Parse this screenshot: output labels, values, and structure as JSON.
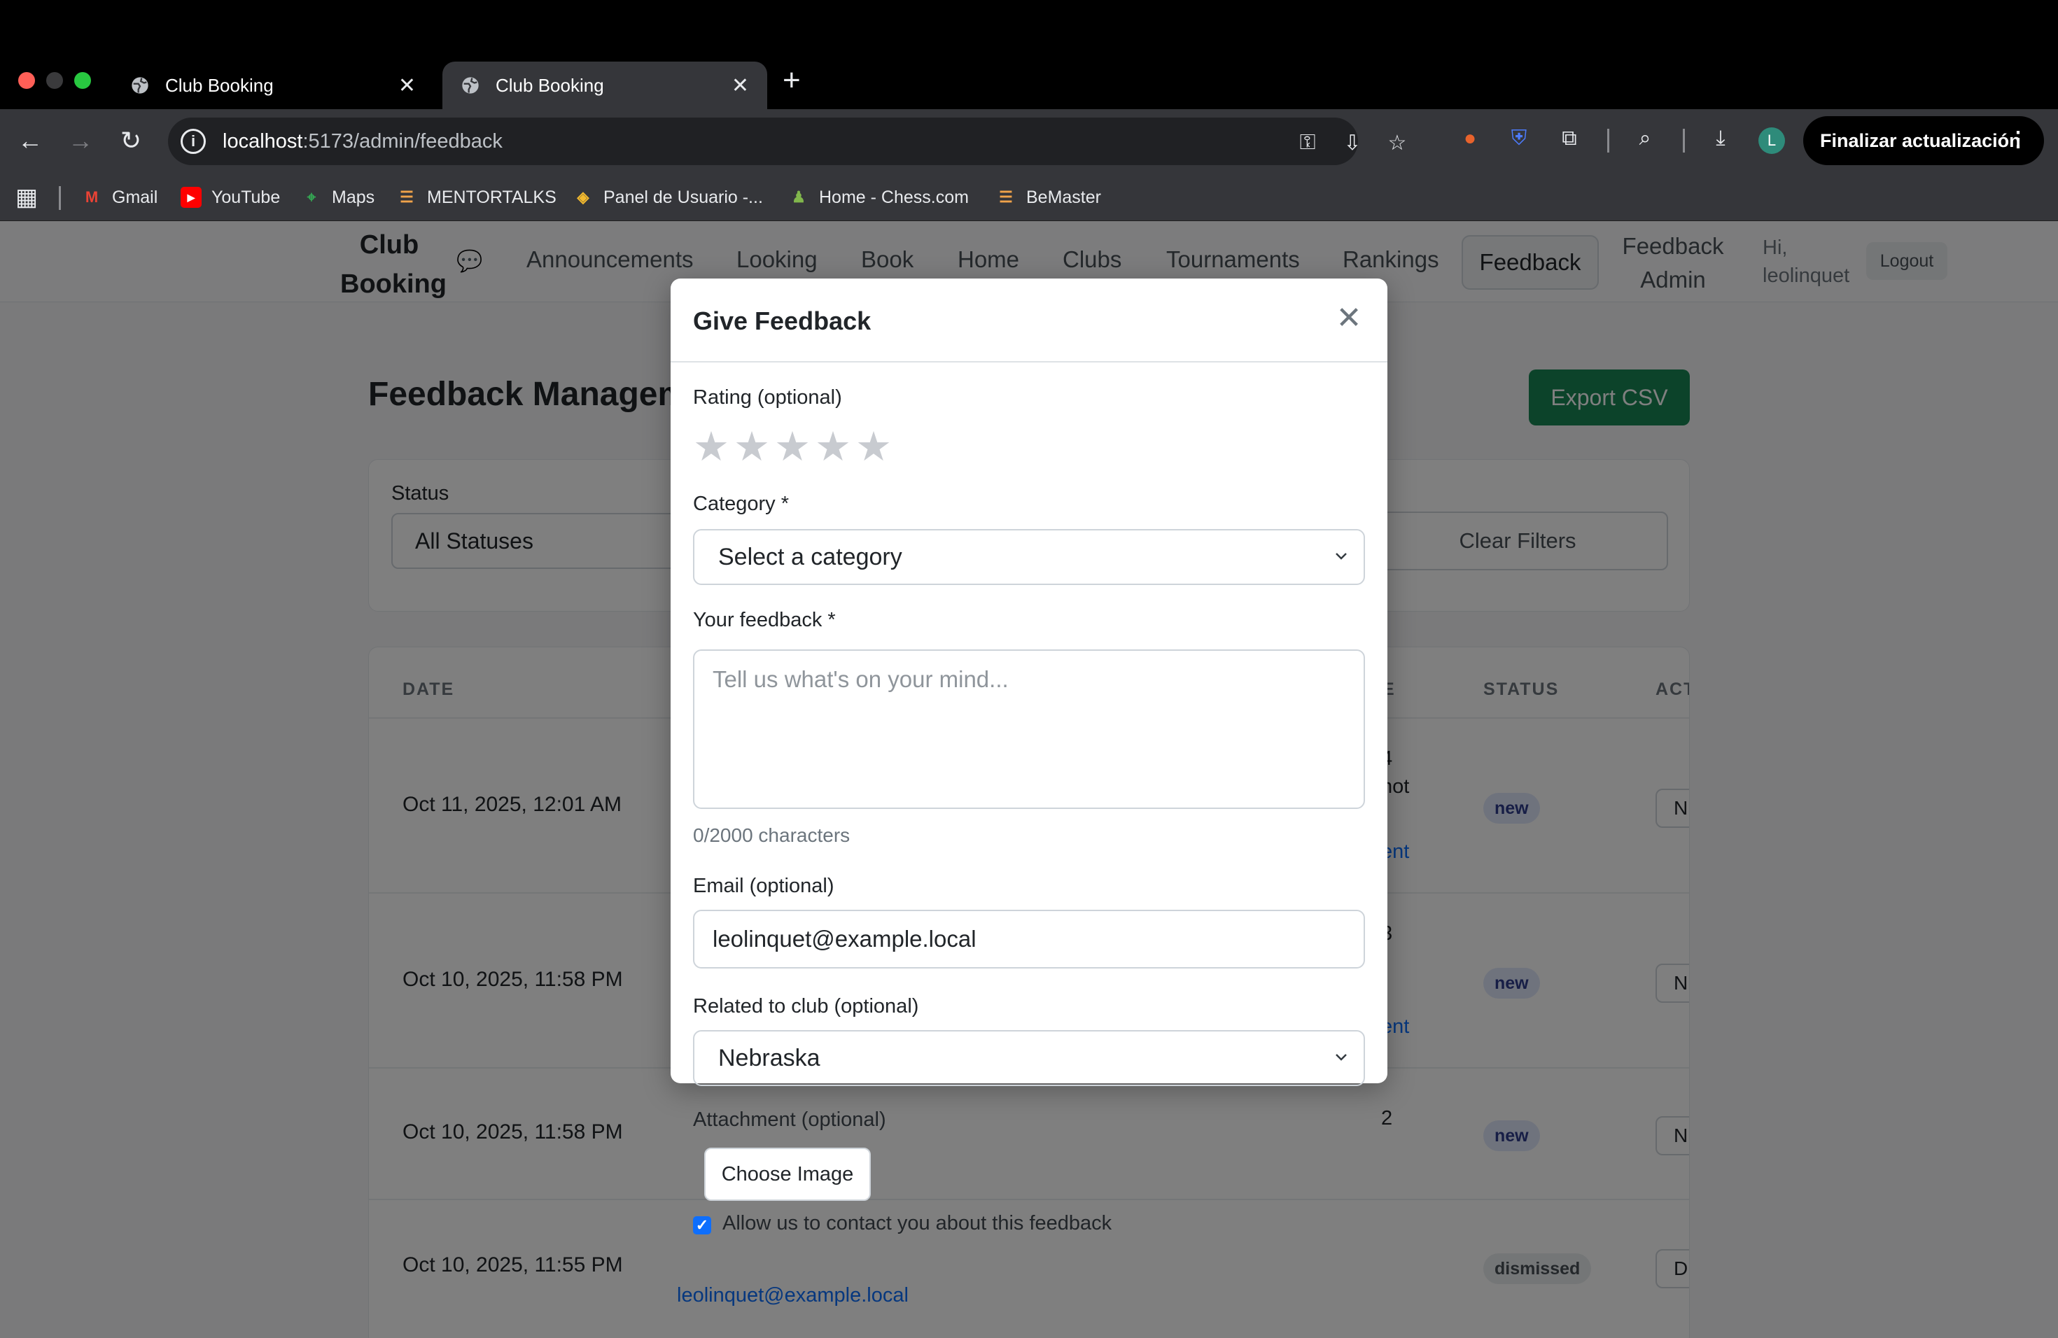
{
  "browser": {
    "tabs": [
      {
        "title": "Club Booking",
        "active": false
      },
      {
        "title": "Club Booking",
        "active": true
      }
    ],
    "new_tab_glyph": "+",
    "url_host": "localhost",
    "url_path": ":5173/admin/feedback",
    "update_button": "Finalizar actualización",
    "profile_initial": "L",
    "bookmarks": [
      {
        "label": "Gmail",
        "icon": "gmail-icon"
      },
      {
        "label": "YouTube",
        "icon": "youtube-icon"
      },
      {
        "label": "Maps",
        "icon": "maps-icon"
      },
      {
        "label": "MENTORTALKS",
        "icon": "mentortalks-icon"
      },
      {
        "label": "Panel de Usuario -...",
        "icon": "binance-icon"
      },
      {
        "label": "Home - Chess.com",
        "icon": "chess-icon"
      },
      {
        "label": "BeMaster",
        "icon": "bemaster-icon"
      }
    ]
  },
  "navbar": {
    "brand_line1": "Club",
    "brand_line2": "Booking",
    "links": [
      "Announcements",
      "Looking",
      "Book",
      "Home",
      "Clubs",
      "Tournaments",
      "Rankings"
    ],
    "active": "Feedback",
    "admin_line1": "Feedback",
    "admin_line2": "Admin",
    "greeting_line1": "Hi,",
    "greeting_line2": "leolinquet",
    "logout": "Logout"
  },
  "page": {
    "title": "Feedback Management",
    "export_button": "Export CSV",
    "filters": {
      "status_label": "Status",
      "status_value": "All Statuses",
      "clear_button": "Clear Filters"
    },
    "table": {
      "columns": [
        "DATE",
        "E",
        "STATUS",
        "ACT"
      ],
      "rows": [
        {
          "date": "Oct 11, 2025, 12:01 AM",
          "frag1": "4",
          "frag2": "not",
          "link": "ent",
          "status": "new",
          "action": "N"
        },
        {
          "date": "Oct 10, 2025, 11:58 PM",
          "frag1": "3",
          "frag2": "",
          "link": "ent",
          "status": "new",
          "action": "N"
        },
        {
          "date": "Oct 10, 2025, 11:58 PM",
          "frag1": "2",
          "frag2": "",
          "link": "",
          "status": "new",
          "action": "N"
        },
        {
          "date": "Oct 10, 2025, 11:55 PM",
          "frag1": "",
          "frag2": "",
          "link": "",
          "status": "dismissed",
          "action": "D"
        }
      ],
      "bottom_email": "leolinquet@example.local"
    }
  },
  "modal": {
    "title": "Give Feedback",
    "rating_label": "Rating (optional)",
    "rating_value": 0,
    "rating_max": 5,
    "category_label": "Category *",
    "category_value": "Select a category",
    "feedback_label": "Your feedback *",
    "feedback_placeholder": "Tell us what's on your mind...",
    "char_count": "0/2000 characters",
    "email_label": "Email (optional)",
    "email_value": "leolinquet@example.local",
    "club_label": "Related to club (optional)",
    "club_value": "Nebraska",
    "attachment_label": "Attachment (optional)",
    "attachment_button": "Choose Image",
    "contact_checked": true,
    "contact_label": "Allow us to contact you about this feedback"
  },
  "colors": {
    "accent": "#0d6efd",
    "export": "#198754",
    "badge_new_bg": "#dfe6fb",
    "badge_dismissed_bg": "#e9ecef"
  }
}
